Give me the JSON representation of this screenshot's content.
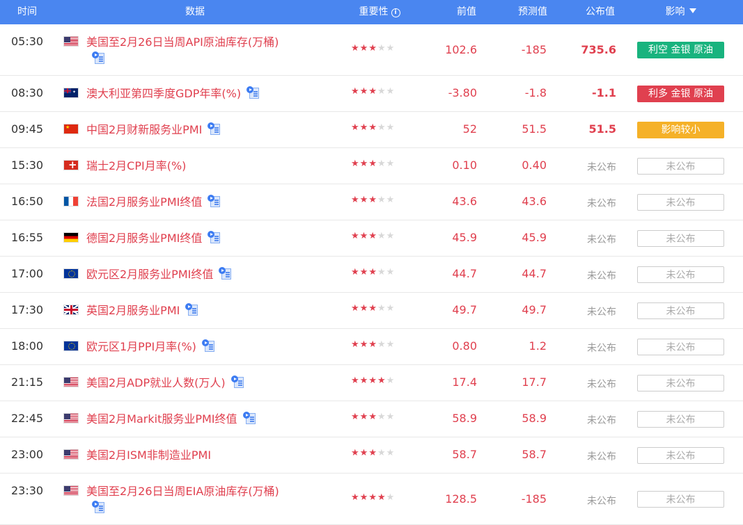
{
  "header": {
    "time": "时间",
    "data": "数据",
    "importance": "重要性",
    "previous": "前值",
    "forecast": "预测值",
    "actual": "公布值",
    "impact": "影响"
  },
  "colors": {
    "header_bg": "#4a86f0",
    "red": "#e0404f",
    "green": "#19b37e",
    "orange": "#f5b128"
  },
  "rows": [
    {
      "time": "05:30",
      "flag": "us",
      "name": "美国至2月26日当周API原油库存(万桶)",
      "video": true,
      "stars": 3,
      "previous": "102.6",
      "forecast": "-185",
      "actual": "735.6",
      "impact": "利空 金银 原油",
      "impact_type": "green"
    },
    {
      "time": "08:30",
      "flag": "au",
      "name": "澳大利亚第四季度GDP年率(%)",
      "video": true,
      "stars": 3,
      "previous": "-3.80",
      "forecast": "-1.8",
      "actual": "-1.1",
      "impact": "利多 金银 原油",
      "impact_type": "red"
    },
    {
      "time": "09:45",
      "flag": "cn",
      "name": "中国2月财新服务业PMI",
      "video": true,
      "stars": 3,
      "previous": "52",
      "forecast": "51.5",
      "actual": "51.5",
      "impact": "影响较小",
      "impact_type": "orange"
    },
    {
      "time": "15:30",
      "flag": "ch",
      "name": "瑞士2月CPI月率(%)",
      "video": false,
      "stars": 3,
      "previous": "0.10",
      "forecast": "0.40",
      "actual": "未公布",
      "impact": "未公布",
      "impact_type": "none"
    },
    {
      "time": "16:50",
      "flag": "fr",
      "name": "法国2月服务业PMI终值",
      "video": true,
      "stars": 3,
      "previous": "43.6",
      "forecast": "43.6",
      "actual": "未公布",
      "impact": "未公布",
      "impact_type": "none"
    },
    {
      "time": "16:55",
      "flag": "de",
      "name": "德国2月服务业PMI终值",
      "video": true,
      "stars": 3,
      "previous": "45.9",
      "forecast": "45.9",
      "actual": "未公布",
      "impact": "未公布",
      "impact_type": "none"
    },
    {
      "time": "17:00",
      "flag": "eu",
      "name": "欧元区2月服务业PMI终值",
      "video": true,
      "stars": 3,
      "previous": "44.7",
      "forecast": "44.7",
      "actual": "未公布",
      "impact": "未公布",
      "impact_type": "none"
    },
    {
      "time": "17:30",
      "flag": "gb",
      "name": "英国2月服务业PMI",
      "video": true,
      "stars": 3,
      "previous": "49.7",
      "forecast": "49.7",
      "actual": "未公布",
      "impact": "未公布",
      "impact_type": "none"
    },
    {
      "time": "18:00",
      "flag": "eu",
      "name": "欧元区1月PPI月率(%)",
      "video": true,
      "stars": 3,
      "previous": "0.80",
      "forecast": "1.2",
      "actual": "未公布",
      "impact": "未公布",
      "impact_type": "none"
    },
    {
      "time": "21:15",
      "flag": "us",
      "name": "美国2月ADP就业人数(万人)",
      "video": true,
      "stars": 4,
      "previous": "17.4",
      "forecast": "17.7",
      "actual": "未公布",
      "impact": "未公布",
      "impact_type": "none"
    },
    {
      "time": "22:45",
      "flag": "us",
      "name": "美国2月Markit服务业PMI终值",
      "video": true,
      "stars": 3,
      "previous": "58.9",
      "forecast": "58.9",
      "actual": "未公布",
      "impact": "未公布",
      "impact_type": "none"
    },
    {
      "time": "23:00",
      "flag": "us",
      "name": "美国2月ISM非制造业PMI",
      "video": false,
      "stars": 3,
      "previous": "58.7",
      "forecast": "58.7",
      "actual": "未公布",
      "impact": "未公布",
      "impact_type": "none"
    },
    {
      "time": "23:30",
      "flag": "us",
      "name": "美国至2月26日当周EIA原油库存(万桶)",
      "video": true,
      "stars": 4,
      "previous": "128.5",
      "forecast": "-185",
      "actual": "未公布",
      "impact": "未公布",
      "impact_type": "none"
    }
  ]
}
